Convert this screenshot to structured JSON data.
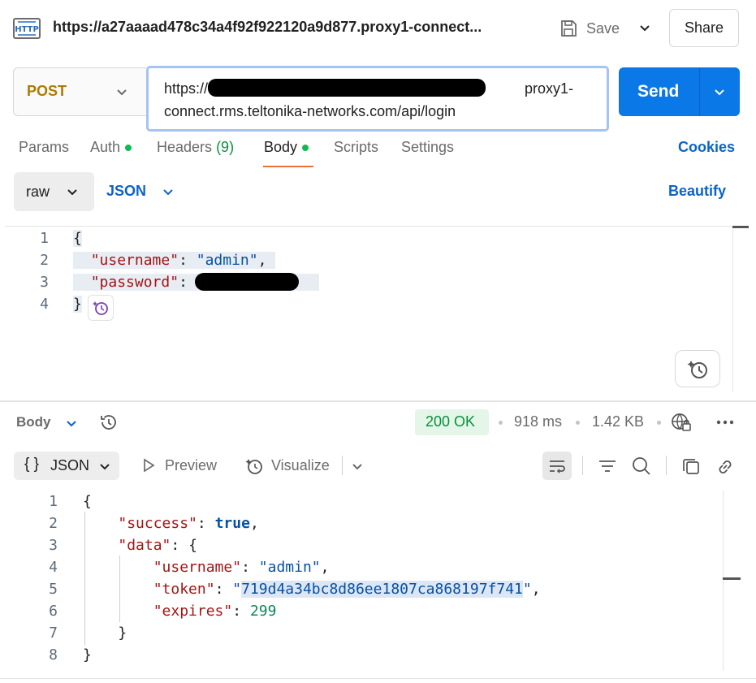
{
  "tab": {
    "icon": "http-icon",
    "url_title": "https://a27aaaad478c34a4f92f922120a9d877.proxy1-connect..."
  },
  "toolbar": {
    "save_label": "Save",
    "share_label": "Share"
  },
  "request": {
    "method": "POST",
    "url_prefix": "https://",
    "url_middle": "proxy1-",
    "url_line2": "connect.rms.teltonika-networks.com/api/login",
    "send_label": "Send"
  },
  "request_tabs": {
    "params": "Params",
    "auth": "Auth",
    "headers": "Headers",
    "headers_count": "(9)",
    "body": "Body",
    "scripts": "Scripts",
    "settings": "Settings",
    "cookies": "Cookies"
  },
  "body_mode": {
    "raw": "raw",
    "format": "JSON",
    "beautify": "Beautify"
  },
  "request_body": {
    "line_numbers": [
      "1",
      "2",
      "3",
      "4"
    ],
    "open_brace": "{",
    "close_brace": "}",
    "username_key": "\"username\"",
    "username_value": "\"admin\"",
    "password_key": "\"password\"",
    "password_value_hidden": "\"\"",
    "colon": ": ",
    "comma": ","
  },
  "response_header": {
    "body_label": "Body",
    "status": "200 OK",
    "time": "918 ms",
    "size": "1.42 KB"
  },
  "response_toolbar": {
    "format_braces": "{ }",
    "format_label": "JSON",
    "preview_label": "Preview",
    "visualize_label": "Visualize"
  },
  "response_body": {
    "line_numbers": [
      "1",
      "2",
      "3",
      "4",
      "5",
      "6",
      "7",
      "8"
    ],
    "open_brace": "{",
    "close_brace": "}",
    "success_key": "\"success\"",
    "success_value": "true",
    "data_key": "\"data\"",
    "username_key": "\"username\"",
    "username_value": "\"admin\"",
    "token_key": "\"token\"",
    "token_value": "719d4a34bc8d86ee1807ca868197f741",
    "expires_key": "\"expires\"",
    "expires_value": "299",
    "colon": ": ",
    "comma": ",",
    "quote": "\""
  },
  "colors": {
    "send_button": "#0b78e7",
    "method_post": "#ad7a03",
    "link_blue": "#0b63c9",
    "status_green": "#0a8f3e",
    "active_tab_underline": "#e8743b"
  }
}
